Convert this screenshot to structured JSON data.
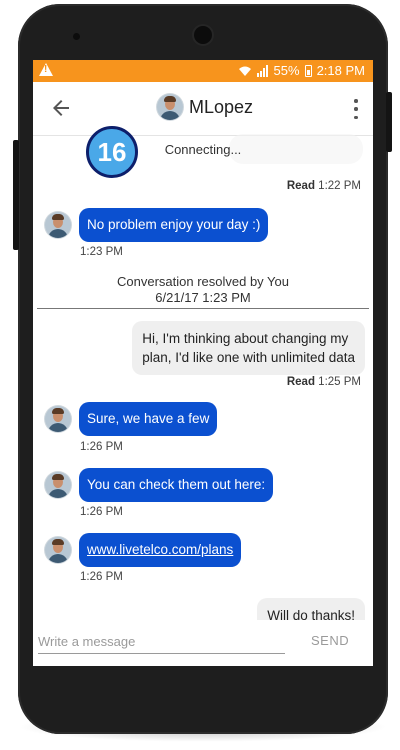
{
  "status_bar": {
    "battery": "55%",
    "time": "2:18 PM",
    "background": "#f7941d"
  },
  "header": {
    "title": "MLopez",
    "icons": [
      "back-arrow-icon",
      "avatar",
      "more-vertical-icon"
    ]
  },
  "chat": {
    "connecting_text": "Connecting...",
    "badge_count": "16",
    "messages": [
      {
        "direction": "out",
        "meta_prefix": "Read",
        "time": "1:22 PM"
      },
      {
        "direction": "in",
        "text": "No problem enjoy your day :)",
        "time": "1:23 PM"
      },
      {
        "type": "system",
        "line1": "Conversation resolved by You",
        "line2": "6/21/17 1:23 PM"
      },
      {
        "direction": "out",
        "line1": "Hi, I'm thinking about changing my",
        "line2": "plan, I'd like one with unlimited data",
        "meta_prefix": "Read",
        "time": "1:25 PM"
      },
      {
        "direction": "in",
        "text": "Sure, we have a few",
        "time": "1:26 PM"
      },
      {
        "direction": "in",
        "text": "You can check them out here:",
        "time": "1:26 PM"
      },
      {
        "direction": "in",
        "text": "www.livetelco.com/plans",
        "is_link": true,
        "time": "1:26 PM"
      },
      {
        "direction": "out",
        "text": "Will do thanks!"
      }
    ]
  },
  "composer": {
    "placeholder": "Write a message",
    "send_label": "SEND"
  },
  "colors": {
    "incoming_bubble": "#0b50d0",
    "outgoing_bubble": "#efefef",
    "badge": "#4aa8e8"
  }
}
